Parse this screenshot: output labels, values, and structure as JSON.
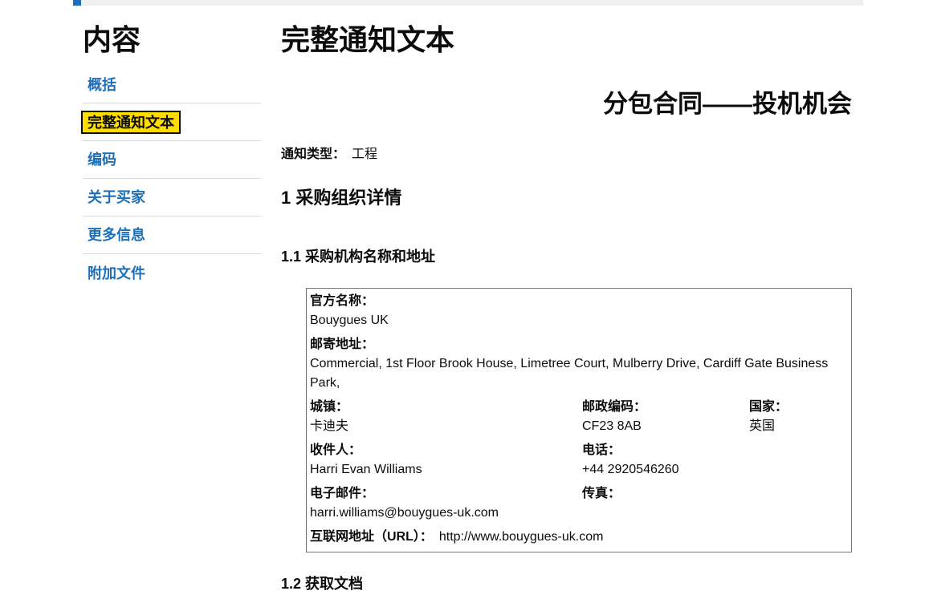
{
  "sidebar": {
    "heading": "内容",
    "items": [
      {
        "label": "概括"
      },
      {
        "label": "完整通知文本"
      },
      {
        "label": "编码"
      },
      {
        "label": "关于买家"
      },
      {
        "label": "更多信息"
      },
      {
        "label": "附加文件"
      }
    ],
    "active_index": 1
  },
  "main": {
    "title": "完整通知文本",
    "notice_title": "分包合同——投机机会",
    "notice_type_label": "通知类型：",
    "notice_type_value": "工程",
    "section1": "1 采购组织详情",
    "section1_1": "1.1 采购机构名称和地址",
    "section1_2": "1.2 获取文档"
  },
  "org": {
    "official_name_label": "官方名称：",
    "official_name": "Bouygues UK",
    "postal_address_label": "邮寄地址：",
    "postal_address": "Commercial, 1st Floor Brook House, Limetree Court, Mulberry Drive, Cardiff Gate Business Park,",
    "town_label": "城镇：",
    "town": "卡迪夫",
    "postcode_label": "邮政编码：",
    "postcode": "CF23 8AB",
    "country_label": "国家：",
    "country": "英国",
    "contact_label": "收件人：",
    "contact": "Harri Evan Williams",
    "phone_label": "电话：",
    "phone": "+44 2920546260",
    "email_label": "电子邮件：",
    "email": "harri.williams@bouygues-uk.com",
    "fax_label": "传真：",
    "fax": "",
    "url_label": "互联网地址（URL）：",
    "url": "http://www.bouygues-uk.com"
  },
  "colors": {
    "link": "#1d70b8",
    "active_highlight": "#ffdd00",
    "text": "#0b0c0c"
  }
}
